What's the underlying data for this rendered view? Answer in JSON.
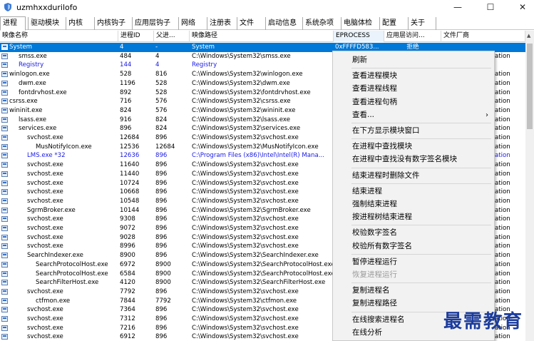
{
  "window": {
    "title": "uzmhxxdurilofo",
    "minimize": "—",
    "maximize": "☐",
    "close": "✕"
  },
  "tabs": [
    "进程",
    "驱动模块",
    "内核",
    "内核钩子",
    "应用层钩子",
    "网络",
    "注册表",
    "文件",
    "启动信息",
    "系统杂项",
    "电脑体检",
    "配置",
    "关于"
  ],
  "columns": [
    "映像名称",
    "进程ID",
    "父进...",
    "映像路径",
    "EPROCESS",
    "应用层访问...",
    "文件厂商"
  ],
  "rows": [
    {
      "name": "System",
      "pid": "4",
      "ppid": "-",
      "path": "System",
      "eproc": "0xFFFFD583...",
      "access": "拒绝",
      "vendor": "",
      "indent": 0,
      "selected": true
    },
    {
      "name": "smss.exe",
      "pid": "484",
      "ppid": "4",
      "path": "C:\\Windows\\System32\\smss.exe",
      "eproc": "",
      "access": "",
      "vendor": "ation",
      "indent": 1
    },
    {
      "name": "Registry",
      "pid": "144",
      "ppid": "4",
      "path": "Registry",
      "eproc": "",
      "access": "",
      "vendor": "",
      "indent": 1,
      "blue": true
    },
    {
      "name": "winlogon.exe",
      "pid": "528",
      "ppid": "816",
      "path": "C:\\Windows\\System32\\winlogon.exe",
      "eproc": "",
      "access": "",
      "vendor": "ation",
      "indent": 0
    },
    {
      "name": "dwm.exe",
      "pid": "1196",
      "ppid": "528",
      "path": "C:\\Windows\\System32\\dwm.exe",
      "eproc": "",
      "access": "",
      "vendor": "ation",
      "indent": 1
    },
    {
      "name": "fontdrvhost.exe",
      "pid": "892",
      "ppid": "528",
      "path": "C:\\Windows\\System32\\fontdrvhost.exe",
      "eproc": "",
      "access": "",
      "vendor": "ation",
      "indent": 1
    },
    {
      "name": "csrss.exe",
      "pid": "716",
      "ppid": "576",
      "path": "C:\\Windows\\System32\\csrss.exe",
      "eproc": "",
      "access": "",
      "vendor": "ation",
      "indent": 0
    },
    {
      "name": "wininit.exe",
      "pid": "824",
      "ppid": "576",
      "path": "C:\\Windows\\System32\\wininit.exe",
      "eproc": "",
      "access": "",
      "vendor": "ation",
      "indent": 0
    },
    {
      "name": "lsass.exe",
      "pid": "916",
      "ppid": "824",
      "path": "C:\\Windows\\System32\\lsass.exe",
      "eproc": "",
      "access": "",
      "vendor": "ation",
      "indent": 1
    },
    {
      "name": "services.exe",
      "pid": "896",
      "ppid": "824",
      "path": "C:\\Windows\\System32\\services.exe",
      "eproc": "",
      "access": "",
      "vendor": "ation",
      "indent": 1
    },
    {
      "name": "svchost.exe",
      "pid": "12684",
      "ppid": "896",
      "path": "C:\\Windows\\System32\\svchost.exe",
      "eproc": "",
      "access": "",
      "vendor": "ation",
      "indent": 2
    },
    {
      "name": "MusNotifyIcon.exe",
      "pid": "12536",
      "ppid": "12684",
      "path": "C:\\Windows\\System32\\MusNotifyIcon.exe",
      "eproc": "",
      "access": "",
      "vendor": "ation",
      "indent": 3
    },
    {
      "name": "LMS.exe *32",
      "pid": "12636",
      "ppid": "896",
      "path": "C:\\Program Files (x86)\\Intel\\Intel(R) Mana...",
      "eproc": "",
      "access": "",
      "vendor": "ation",
      "indent": 2,
      "blue": true
    },
    {
      "name": "svchost.exe",
      "pid": "11640",
      "ppid": "896",
      "path": "C:\\Windows\\System32\\svchost.exe",
      "eproc": "",
      "access": "",
      "vendor": "ation",
      "indent": 2
    },
    {
      "name": "svchost.exe",
      "pid": "11440",
      "ppid": "896",
      "path": "C:\\Windows\\System32\\svchost.exe",
      "eproc": "",
      "access": "",
      "vendor": "ation",
      "indent": 2
    },
    {
      "name": "svchost.exe",
      "pid": "10724",
      "ppid": "896",
      "path": "C:\\Windows\\System32\\svchost.exe",
      "eproc": "",
      "access": "",
      "vendor": "ation",
      "indent": 2
    },
    {
      "name": "svchost.exe",
      "pid": "10668",
      "ppid": "896",
      "path": "C:\\Windows\\System32\\svchost.exe",
      "eproc": "",
      "access": "",
      "vendor": "ation",
      "indent": 2
    },
    {
      "name": "svchost.exe",
      "pid": "10548",
      "ppid": "896",
      "path": "C:\\Windows\\System32\\svchost.exe",
      "eproc": "",
      "access": "",
      "vendor": "ation",
      "indent": 2
    },
    {
      "name": "SgrmBroker.exe",
      "pid": "10144",
      "ppid": "896",
      "path": "C:\\Windows\\System32\\SgrmBroker.exe",
      "eproc": "",
      "access": "",
      "vendor": "ation",
      "indent": 2
    },
    {
      "name": "svchost.exe",
      "pid": "9308",
      "ppid": "896",
      "path": "C:\\Windows\\System32\\svchost.exe",
      "eproc": "",
      "access": "",
      "vendor": "ation",
      "indent": 2
    },
    {
      "name": "svchost.exe",
      "pid": "9072",
      "ppid": "896",
      "path": "C:\\Windows\\System32\\svchost.exe",
      "eproc": "",
      "access": "",
      "vendor": "ation",
      "indent": 2
    },
    {
      "name": "svchost.exe",
      "pid": "9028",
      "ppid": "896",
      "path": "C:\\Windows\\System32\\svchost.exe",
      "eproc": "",
      "access": "",
      "vendor": "ation",
      "indent": 2
    },
    {
      "name": "svchost.exe",
      "pid": "8996",
      "ppid": "896",
      "path": "C:\\Windows\\System32\\svchost.exe",
      "eproc": "",
      "access": "",
      "vendor": "ation",
      "indent": 2
    },
    {
      "name": "SearchIndexer.exe",
      "pid": "8900",
      "ppid": "896",
      "path": "C:\\Windows\\System32\\SearchIndexer.exe",
      "eproc": "",
      "access": "",
      "vendor": "ation",
      "indent": 2
    },
    {
      "name": "SearchProtocolHost.exe",
      "pid": "6972",
      "ppid": "8900",
      "path": "C:\\Windows\\System32\\SearchProtocolHost.exe",
      "eproc": "",
      "access": "",
      "vendor": "ation",
      "indent": 3
    },
    {
      "name": "SearchProtocolHost.exe",
      "pid": "6584",
      "ppid": "8900",
      "path": "C:\\Windows\\System32\\SearchProtocolHost.exe",
      "eproc": "",
      "access": "",
      "vendor": "ation",
      "indent": 3
    },
    {
      "name": "SearchFilterHost.exe",
      "pid": "4120",
      "ppid": "8900",
      "path": "C:\\Windows\\System32\\SearchFilterHost.exe",
      "eproc": "",
      "access": "",
      "vendor": "ation",
      "indent": 3
    },
    {
      "name": "svchost.exe",
      "pid": "7792",
      "ppid": "896",
      "path": "C:\\Windows\\System32\\svchost.exe",
      "eproc": "",
      "access": "",
      "vendor": "ation",
      "indent": 2
    },
    {
      "name": "ctfmon.exe",
      "pid": "7844",
      "ppid": "7792",
      "path": "C:\\Windows\\System32\\ctfmon.exe",
      "eproc": "",
      "access": "",
      "vendor": "ation",
      "indent": 3
    },
    {
      "name": "svchost.exe",
      "pid": "7364",
      "ppid": "896",
      "path": "C:\\Windows\\System32\\svchost.exe",
      "eproc": "",
      "access": "",
      "vendor": "ation",
      "indent": 2
    },
    {
      "name": "svchost.exe",
      "pid": "7312",
      "ppid": "896",
      "path": "C:\\Windows\\System32\\svchost.exe",
      "eproc": "",
      "access": "",
      "vendor": "ation",
      "indent": 2
    },
    {
      "name": "svchost.exe",
      "pid": "7216",
      "ppid": "896",
      "path": "C:\\Windows\\System32\\svchost.exe",
      "eproc": "",
      "access": "",
      "vendor": "ation",
      "indent": 2
    },
    {
      "name": "svchost.exe",
      "pid": "6912",
      "ppid": "896",
      "path": "C:\\Windows\\System32\\svchost.exe",
      "eproc": "",
      "access": "",
      "vendor": "ation",
      "indent": 2
    }
  ],
  "context_menu": [
    {
      "label": "刷新"
    },
    {
      "sep": true
    },
    {
      "label": "查看进程模块"
    },
    {
      "label": "查看进程线程"
    },
    {
      "label": "查看进程句柄"
    },
    {
      "label": "查看...",
      "submenu": true
    },
    {
      "sep": true
    },
    {
      "label": "在下方显示模块窗口"
    },
    {
      "sep": true
    },
    {
      "label": "在进程中查找模块"
    },
    {
      "label": "在进程中查找没有数字签名模块"
    },
    {
      "sep": true
    },
    {
      "label": "结束进程时删除文件"
    },
    {
      "sep": true
    },
    {
      "label": "结束进程"
    },
    {
      "label": "强制结束进程"
    },
    {
      "label": "按进程树结束进程"
    },
    {
      "sep": true
    },
    {
      "label": "校验数字签名"
    },
    {
      "label": "校验所有数字签名"
    },
    {
      "sep": true
    },
    {
      "label": "暂停进程运行"
    },
    {
      "label": "恢复进程运行",
      "disabled": true
    },
    {
      "sep": true
    },
    {
      "label": "复制进程名"
    },
    {
      "label": "复制进程路径"
    },
    {
      "sep": true
    },
    {
      "label": "在线搜索进程名"
    },
    {
      "label": "在线分析"
    }
  ],
  "watermark": "最需教育",
  "colors": {
    "selection": "#0078d7",
    "blue_text": "#1a1ae6"
  }
}
